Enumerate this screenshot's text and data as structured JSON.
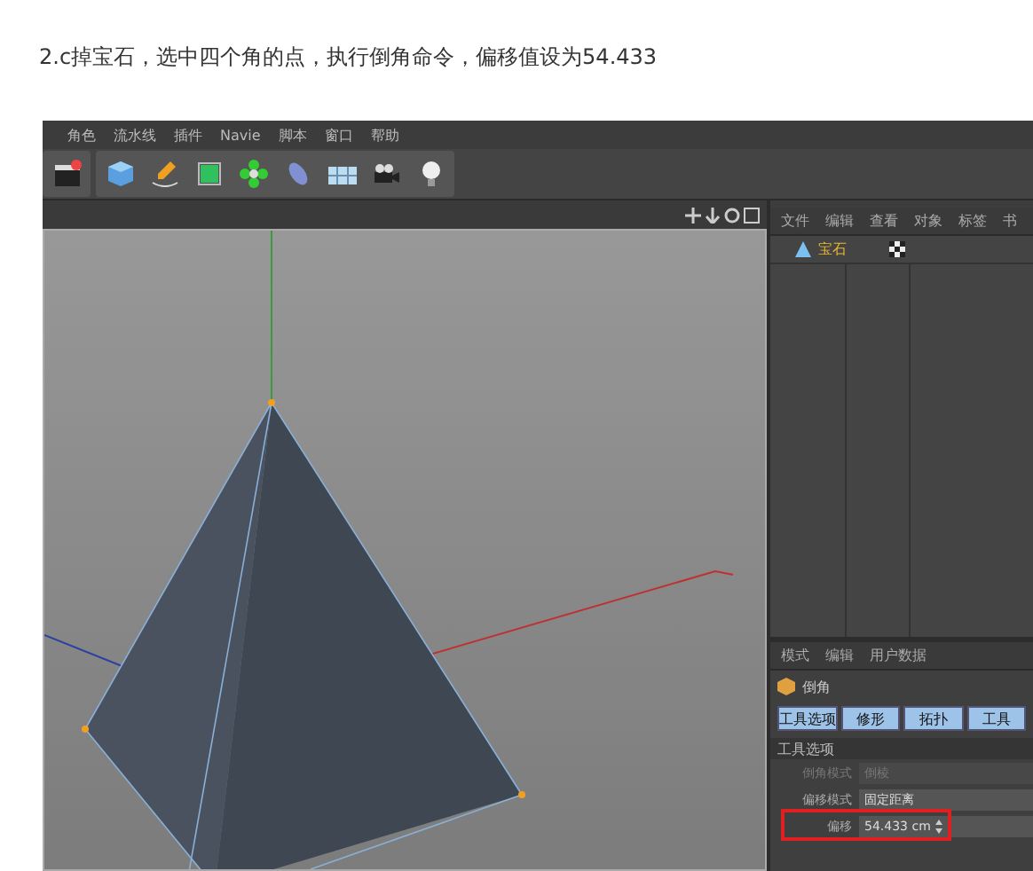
{
  "heading": "2.c掉宝石，选中四个角的点，执行倒角命令，偏移值设为54.433",
  "app": {
    "menu": [
      "角色",
      "流水线",
      "插件",
      "Navie",
      "脚本",
      "窗口",
      "帮助"
    ],
    "object_manager": {
      "menu": [
        "文件",
        "编辑",
        "查看",
        "对象",
        "标签",
        "书"
      ],
      "objects": [
        {
          "name": "宝石",
          "selected": true
        }
      ]
    },
    "attributes": {
      "menu": [
        "模式",
        "编辑",
        "用户数据"
      ],
      "title": "倒角",
      "tabs": [
        {
          "label": "工具选项",
          "selected": true
        },
        {
          "label": "修形",
          "selected": true
        },
        {
          "label": "拓扑",
          "selected": true
        },
        {
          "label": "工具",
          "selected": true
        }
      ],
      "section": "工具选项",
      "fields": [
        {
          "label": "倒角模式",
          "value": "倒棱",
          "disabled": true,
          "highlighted": false
        },
        {
          "label": "偏移模式",
          "value": "固定距离",
          "disabled": false,
          "highlighted": false
        },
        {
          "label": "偏移",
          "value": "54.433 cm",
          "disabled": false,
          "highlighted": true
        }
      ]
    }
  }
}
